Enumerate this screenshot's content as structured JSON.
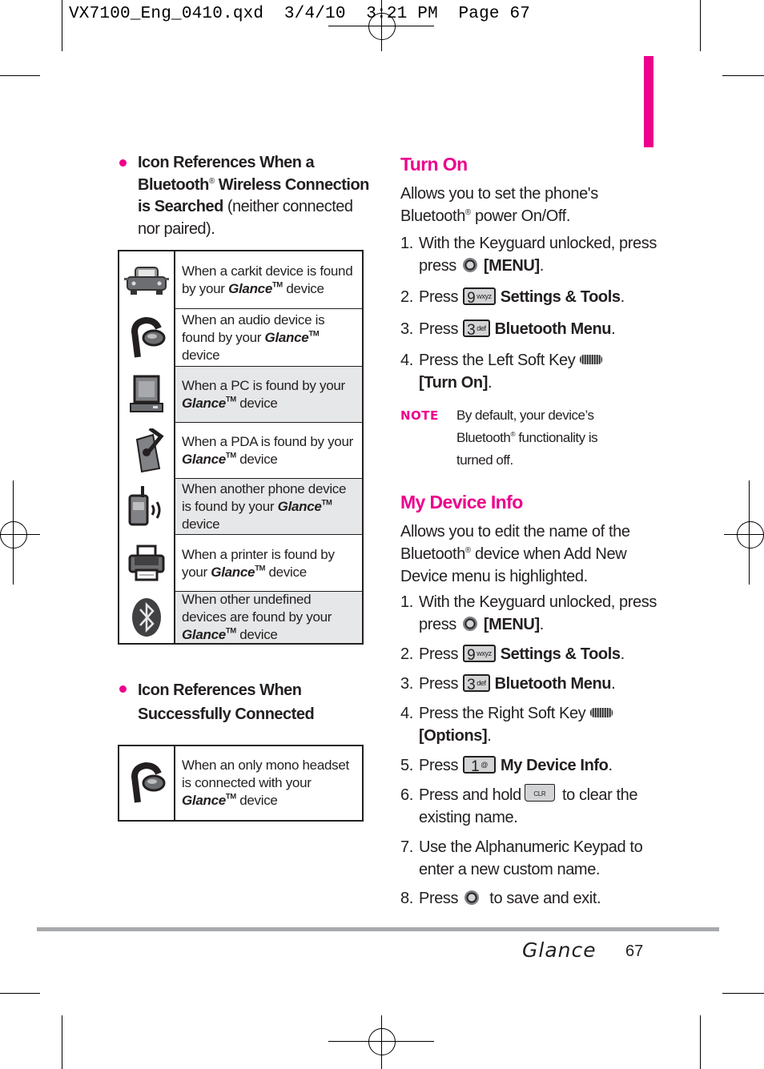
{
  "slug": "VX7100_Eng_0410.qxd  3/4/10  3:21 PM  Page 67",
  "colors": {
    "accent": "#ec008c",
    "shade": "#e6e7e8",
    "rule": "#a7a9ac",
    "text": "#231f20"
  },
  "left": {
    "searched": {
      "bold1": "Icon References When a Bluetooth",
      "reg": "®",
      "bold2": " Wireless Connection is Searched",
      "normal": " (neither connected nor paired)."
    },
    "searched_rows": [
      {
        "icon": "carkit-icon",
        "pre": "When a carkit device is found by your ",
        "brand": "Glance",
        "tm": "TM",
        "post": " device"
      },
      {
        "icon": "audio-headset-icon",
        "pre": "When an audio device is found by your ",
        "brand": "Glance",
        "tm": "TM",
        "post": " device"
      },
      {
        "icon": "pc-icon",
        "pre": "When a PC is found by your ",
        "brand": "Glance",
        "tm": "TM",
        "post": " device"
      },
      {
        "icon": "pda-icon",
        "pre": "When a PDA is found by your ",
        "brand": "Glance",
        "tm": "TM",
        "post": " device"
      },
      {
        "icon": "phone-icon",
        "pre": "When another phone device is found by your ",
        "brand": "Glance",
        "tm": "TM",
        "post": " device"
      },
      {
        "icon": "printer-icon",
        "pre": "When a printer is found by your ",
        "brand": "Glance",
        "tm": "TM",
        "post": " device"
      },
      {
        "icon": "bluetooth-icon",
        "pre": "When other undefined devices are found by your ",
        "brand": "Glance",
        "tm": "TM",
        "post": " device"
      }
    ],
    "connected": {
      "bold": "Icon References When Successfully Connected"
    },
    "connected_rows": [
      {
        "icon": "mono-headset-icon",
        "pre": "When an only mono headset is connected with your ",
        "brand": "Glance",
        "tm": "TM",
        "post": " device"
      }
    ]
  },
  "turn_on": {
    "title": "Turn On",
    "intro_1": "Allows you to set the phone's",
    "intro_2a": "Bluetooth",
    "intro_reg": "®",
    "intro_2b": " power On/Off.",
    "steps": [
      {
        "num": "1.",
        "text_a": "With the Keyguard unlocked, press",
        "key": "ok-key",
        "bold": "[MENU]",
        "end": "."
      },
      {
        "num": "2.",
        "text_a": "Press",
        "key_num": "9",
        "key_letters": "wxyz",
        "bold": "Settings & Tools",
        "end": "."
      },
      {
        "num": "3.",
        "text_a": "Press",
        "key_num": "3",
        "key_letters": "def",
        "bold": "Bluetooth Menu",
        "end": "."
      },
      {
        "num": "4.",
        "text_a": "Press the Left Soft Key",
        "bold": "[Turn On]",
        "end": "."
      }
    ],
    "note_label": "NOTE",
    "note_a": "By default, your device’s Bluetooth",
    "note_reg": "®",
    "note_b": " functionality is turned off."
  },
  "my_device_info": {
    "title": "My Device Info",
    "intro_a": "Allows you to edit the name of the Bluetooth",
    "intro_reg": "®",
    "intro_b": " device when Add New Device menu is highlighted.",
    "steps": [
      {
        "num": "1.",
        "text_a": "With the Keyguard unlocked, press",
        "bold": "[MENU]",
        "end": "."
      },
      {
        "num": "2.",
        "text_a": "Press",
        "key_num": "9",
        "key_letters": "wxyz",
        "bold": "Settings & Tools",
        "end": "."
      },
      {
        "num": "3.",
        "text_a": "Press",
        "key_num": "3",
        "key_letters": "def",
        "bold": "Bluetooth Menu",
        "end": "."
      },
      {
        "num": "4.",
        "text_a": "Press the Right Soft Key",
        "bold": "[Options]",
        "end": "."
      },
      {
        "num": "5.",
        "text_a": "Press",
        "key_num": "1",
        "key_letters": "@",
        "bold": "My Device Info",
        "end": "."
      },
      {
        "num": "6.",
        "text_a": "Press and hold",
        "clr": "CLR",
        "text_b": " to clear the existing name."
      },
      {
        "num": "7.",
        "text_a": "Use the Alphanumeric Keypad to enter a new custom name."
      },
      {
        "num": "8.",
        "text_a": "Press",
        "text_b": " to save and exit."
      }
    ]
  },
  "footer": {
    "brand": "Glance",
    "page": "67"
  }
}
